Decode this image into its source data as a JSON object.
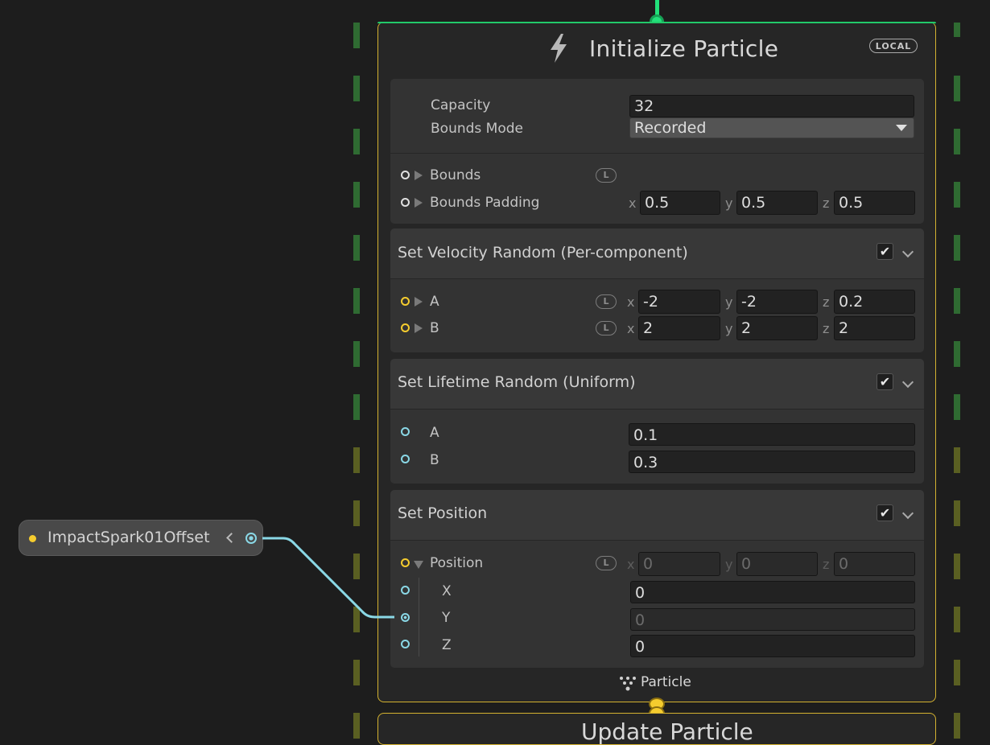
{
  "context": {
    "title": "Initialize Particle",
    "space_badge": "LOCAL",
    "footer_label": "Particle",
    "next_block_title": "Update Particle"
  },
  "settings": {
    "capacity_label": "Capacity",
    "capacity_value": "32",
    "bounds_mode_label": "Bounds Mode",
    "bounds_mode_value": "Recorded",
    "bounds_label": "Bounds",
    "bounds_space": "L",
    "bounds_padding_label": "Bounds Padding",
    "bounds_padding": {
      "x": "0.5",
      "y": "0.5",
      "z": "0.5"
    }
  },
  "blocks": {
    "velocity": {
      "title": "Set Velocity Random (Per-component)",
      "a_label": "A",
      "a": {
        "x": "-2",
        "y": "-2",
        "z": "0.2"
      },
      "b_label": "B",
      "b": {
        "x": "2",
        "y": "2",
        "z": "2"
      },
      "space": "L"
    },
    "lifetime": {
      "title": "Set Lifetime Random (Uniform)",
      "a_label": "A",
      "a_value": "0.1",
      "b_label": "B",
      "b_value": "0.3"
    },
    "position": {
      "title": "Set Position",
      "position_label": "Position",
      "space": "L",
      "position": {
        "x": "0",
        "y": "0",
        "z": "0"
      },
      "x_label": "X",
      "x_value": "0",
      "y_label": "Y",
      "y_value": "0",
      "z_label": "Z",
      "z_value": "0"
    }
  },
  "axis_labels": {
    "x": "x",
    "y": "y",
    "z": "z"
  },
  "parameter_node": {
    "name": "ImpactSpark01Offset"
  },
  "colors": {
    "flow_green": "#22e07a",
    "particle_yellow": "#d4b230",
    "link_cyan": "#8ad8e6",
    "background": "#1d1d1d"
  },
  "icons": {
    "context_icon": "lightning-icon",
    "footer_icon": "particle-icon",
    "checkbox": "checkmark-icon"
  }
}
